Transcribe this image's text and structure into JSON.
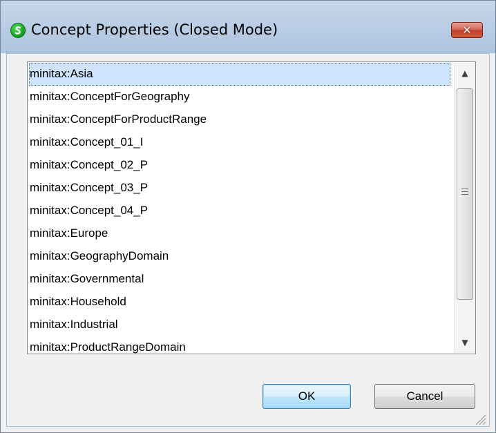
{
  "window": {
    "title": "Concept Properties (Closed Mode)",
    "app_icon": "altova-s-icon",
    "close_label": "✕"
  },
  "list": {
    "selected_index": 0,
    "items": [
      "minitax:Asia",
      "minitax:ConceptForGeography",
      "minitax:ConceptForProductRange",
      "minitax:Concept_01_I",
      "minitax:Concept_02_P",
      "minitax:Concept_03_P",
      "minitax:Concept_04_P",
      "minitax:Europe",
      "minitax:GeographyDomain",
      "minitax:Governmental",
      "minitax:Household",
      "minitax:Industrial",
      "minitax:ProductRangeDomain"
    ]
  },
  "scrollbar": {
    "up_arrow": "▲",
    "down_arrow": "▼"
  },
  "buttons": {
    "ok": "OK",
    "cancel": "Cancel"
  }
}
